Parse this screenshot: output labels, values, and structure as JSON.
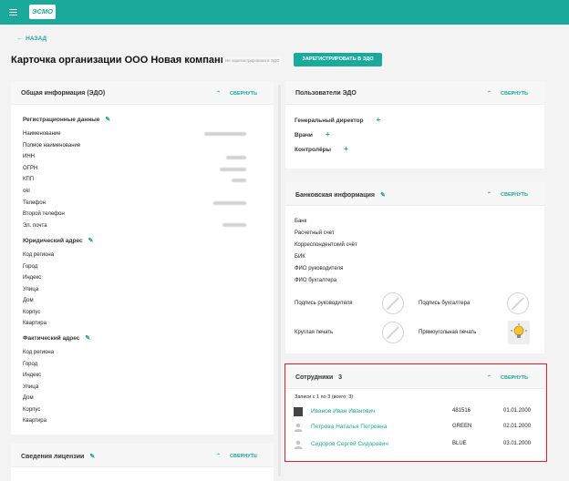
{
  "header": {
    "logo_text": "ЭСМО"
  },
  "nav": {
    "back_label": "НАЗАД"
  },
  "page": {
    "title": "Карточка организации ООО Новая компания",
    "edo_status": "Не зарегистрирована в ЭДО",
    "register_button": "ЗАРЕГИСТРИРОВАТЬ В ЭДО"
  },
  "general": {
    "title": "Общая информация (ЭДО)",
    "collapse_label": "СВЕРНУТЬ",
    "reg_data_title": "Регистрационные данные",
    "reg_fields": [
      "Наименование",
      "Полное наименование",
      "ИНН",
      "ОГРН",
      "КПП",
      "okl",
      "Телефон",
      "Второй телефон",
      "Эл. почта"
    ],
    "legal_address_title": "Юридический адрес",
    "address_fields": [
      "Код региона",
      "Город",
      "Индекс",
      "Улица",
      "Дом",
      "Корпус",
      "Квартира"
    ],
    "actual_address_title": "Фактический адрес"
  },
  "license": {
    "title": "Сведения лицензии",
    "collapse_label": "СВЕРНУТЬ"
  },
  "users": {
    "title": "Пользователи ЭДО",
    "collapse_label": "СВЕРНУТЬ",
    "roles": [
      "Генеральный директор",
      "Врачи",
      "Контролёры"
    ]
  },
  "bank": {
    "title": "Банковская информация",
    "collapse_label": "СВЕРНУТЬ",
    "fields": [
      "Банк",
      "Расчетный счет",
      "Корреспондентский счёт",
      "БИК",
      "ФИО руководителя",
      "ФИО бухгалтера"
    ],
    "stamps": {
      "director_signature": "Подпись руководителя",
      "accountant_signature": "Подпись бухгалтера",
      "round_seal": "Круглая печать",
      "rect_seal": "Прямоугольная печать"
    }
  },
  "employees": {
    "title": "Сотрудники",
    "count": "3",
    "collapse_label": "СВЕРНУТЬ",
    "records_info": "Записи с 1 по 3 (всего: 3)",
    "rows": [
      {
        "name": "Иванов Иван Иванович",
        "code": "481516",
        "date": "01.01.2000",
        "avatar": "photo"
      },
      {
        "name": "Петрова Наталья Петровна",
        "code": "GREEN",
        "date": "02.01.2000",
        "avatar": "person-icon"
      },
      {
        "name": "Сидоров Сергей Сидорович",
        "code": "BLUE",
        "date": "03.01.2000",
        "avatar": "person-icon"
      }
    ]
  },
  "colors": {
    "accent": "#1aa99a",
    "topbar": "#1aa99a",
    "highlight": "#d9232e"
  }
}
